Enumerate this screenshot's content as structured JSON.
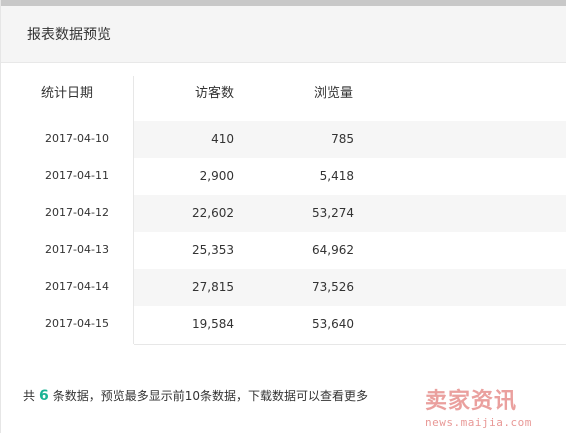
{
  "dialog": {
    "title": "报表数据预览"
  },
  "table": {
    "headers": {
      "date": "统计日期",
      "visitors": "访客数",
      "views": "浏览量"
    },
    "rows": [
      {
        "date": "2017-04-10",
        "visitors": "410",
        "views": "785"
      },
      {
        "date": "2017-04-11",
        "visitors": "2,900",
        "views": "5,418"
      },
      {
        "date": "2017-04-12",
        "visitors": "22,602",
        "views": "53,274"
      },
      {
        "date": "2017-04-13",
        "visitors": "25,353",
        "views": "64,962"
      },
      {
        "date": "2017-04-14",
        "visitors": "27,815",
        "views": "73,526"
      },
      {
        "date": "2017-04-15",
        "visitors": "19,584",
        "views": "53,640"
      }
    ]
  },
  "footer": {
    "prefix": "共",
    "count": "6",
    "suffix": "条数据，预览最多显示前10条数据，下载数据可以查看更多"
  },
  "watermark": {
    "brand": "卖家资讯",
    "url": "news.maijia.com"
  },
  "colors": {
    "accent": "#1ab394",
    "row_alt": "#f6f6f6",
    "header_bg": "#f5f5f5"
  }
}
